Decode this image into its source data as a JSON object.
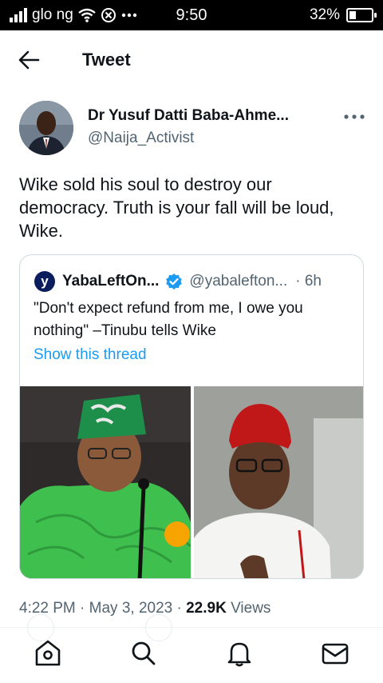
{
  "status_bar": {
    "carrier": "glo ng",
    "time": "9:50",
    "battery_percent": "32%",
    "battery_level": 0.32,
    "icons": [
      "signal-icon",
      "wifi-icon",
      "notification-icon",
      "more-dots-icon",
      "battery-icon"
    ]
  },
  "header": {
    "title": "Tweet",
    "back_icon": "arrow-left-icon"
  },
  "tweet": {
    "author_name": "Dr Yusuf Datti Baba-Ahme...",
    "author_handle": "@Naija_Activist",
    "text": "Wike sold his soul to destroy our democracy. Truth is your fall will be loud, Wike.",
    "timestamp": "4:22 PM · May 3, 2023 · ",
    "views_count": "22.9K",
    "views_label": " Views"
  },
  "quote": {
    "logo_letter": "y",
    "name": "YabaLeftOn...",
    "handle": "@yabalefton...",
    "time": "· 6h",
    "text": "\"Don't expect refund from me, I owe you nothing\" –Tinubu tells Wike",
    "show_thread": "Show this thread"
  },
  "nav": {
    "items": [
      "home-icon",
      "search-icon",
      "notifications-icon",
      "messages-icon"
    ]
  },
  "colors": {
    "accent": "#1d9bf0",
    "text": "#0f1419",
    "secondary": "#536471",
    "border": "#cfd9de"
  }
}
